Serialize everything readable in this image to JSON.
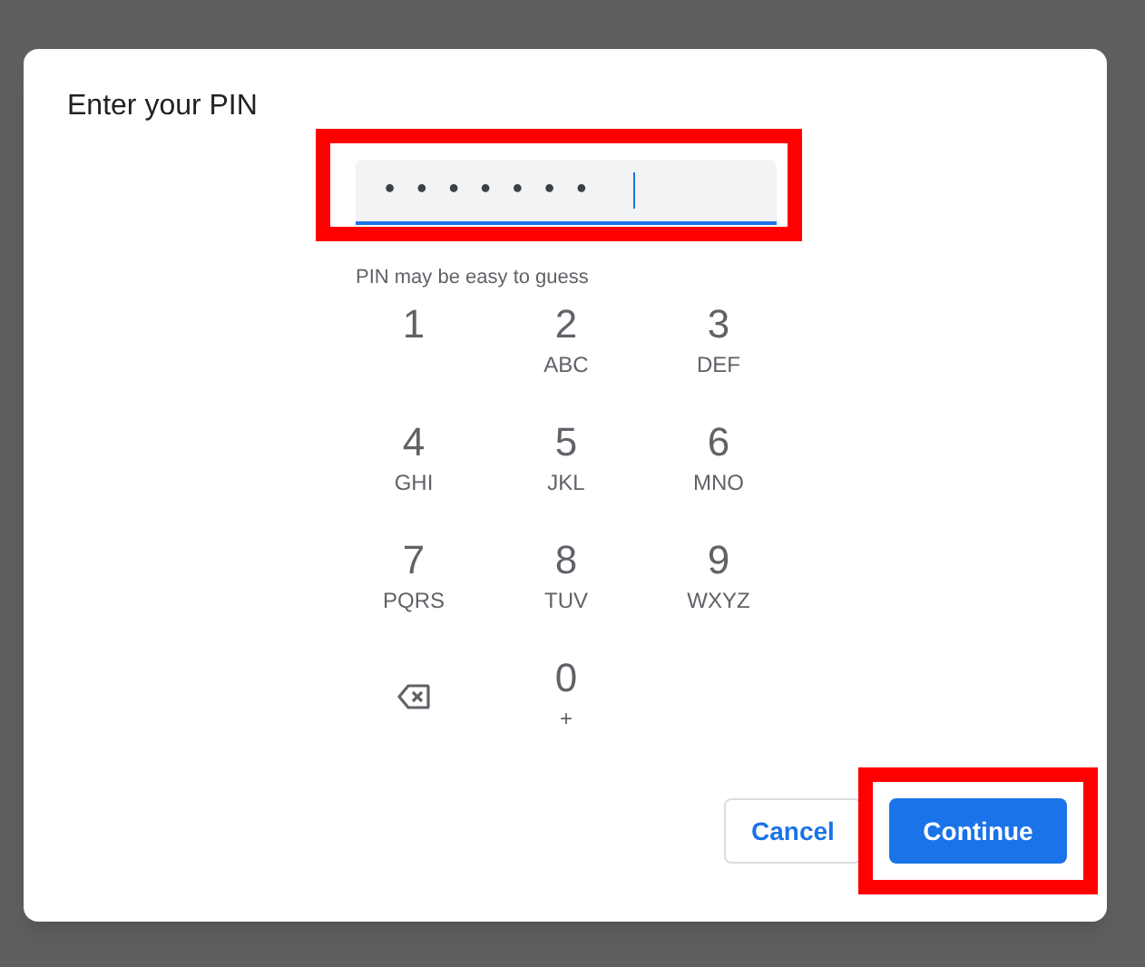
{
  "dialog": {
    "title": "Enter your PIN",
    "pin_field": {
      "value": "•••••••",
      "focused": true,
      "highlighted": true
    },
    "hint": "PIN may be easy to guess",
    "keypad": [
      {
        "kind": "digit",
        "digit": "1"
      },
      {
        "kind": "digit",
        "digit": "2",
        "letters": "ABC"
      },
      {
        "kind": "digit",
        "digit": "3",
        "letters": "DEF"
      },
      {
        "kind": "digit",
        "digit": "4",
        "letters": "GHI"
      },
      {
        "kind": "digit",
        "digit": "5",
        "letters": "JKL"
      },
      {
        "kind": "digit",
        "digit": "6",
        "letters": "MNO"
      },
      {
        "kind": "digit",
        "digit": "7",
        "letters": "PQRS"
      },
      {
        "kind": "digit",
        "digit": "8",
        "letters": "TUV"
      },
      {
        "kind": "digit",
        "digit": "9",
        "letters": "WXYZ"
      },
      {
        "kind": "backspace"
      },
      {
        "kind": "digit",
        "digit": "0",
        "letters": "+"
      }
    ],
    "buttons": [
      {
        "label": "Cancel",
        "primary": false,
        "highlighted": false
      },
      {
        "label": "Continue",
        "primary": true,
        "highlighted": true
      }
    ]
  }
}
